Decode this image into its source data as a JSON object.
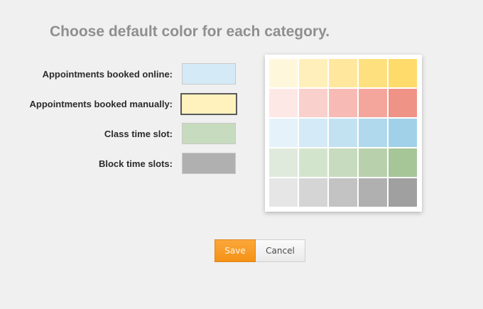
{
  "title": "Choose default color for each category.",
  "categories": [
    {
      "label": "Appointments booked online:",
      "color": "#d4eaf6",
      "selected": false
    },
    {
      "label": "Appointments booked manually:",
      "color": "#fff2bd",
      "selected": true
    },
    {
      "label": "Class time slot:",
      "color": "#c7dbbe",
      "selected": false
    },
    {
      "label": "Block time slots:",
      "color": "#b0b0b0",
      "selected": false
    }
  ],
  "palette": [
    [
      "#fff7dc",
      "#fff0bb",
      "#ffe89e",
      "#ffe07e",
      "#ffdb6c"
    ],
    [
      "#fde8e6",
      "#f9d0cb",
      "#f7bab4",
      "#f4a69c",
      "#f09387"
    ],
    [
      "#e6f2f9",
      "#d4eaf6",
      "#c2e2f2",
      "#b1d9ed",
      "#a1d1e9"
    ],
    [
      "#e0eadc",
      "#d3e4cc",
      "#c7dbbe",
      "#b8d1ac",
      "#a6c698"
    ],
    [
      "#e6e6e6",
      "#d5d5d5",
      "#c3c3c3",
      "#b0b0b0",
      "#a0a0a0"
    ]
  ],
  "buttons": {
    "save": "Save",
    "cancel": "Cancel"
  }
}
